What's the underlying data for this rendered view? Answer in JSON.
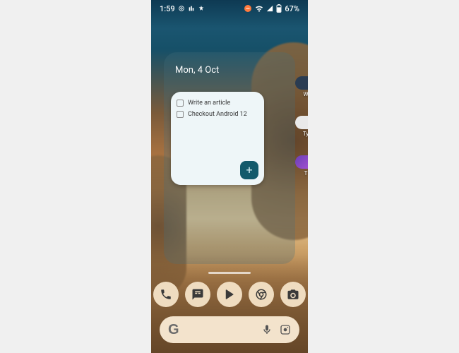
{
  "status": {
    "time": "1:59",
    "battery_pct": "67%"
  },
  "date_widget": {
    "label": "Mon, 4 Oct"
  },
  "todo": {
    "items": [
      {
        "text": "Write an article"
      },
      {
        "text": "Checkout Android 12"
      }
    ],
    "fab": "+"
  },
  "edge_apps": [
    {
      "label": "W",
      "color": "#2a3c52"
    },
    {
      "label": "Ty",
      "color": "#e9e9e9"
    },
    {
      "label": "T",
      "color": "#6a3fb5"
    }
  ],
  "dock": {
    "phone": "Phone",
    "messages": "Messages",
    "play": "Play Store",
    "chrome": "Chrome",
    "camera": "Camera"
  },
  "search": {
    "g": "G"
  },
  "colors": {
    "dock_bg": "#efdcc0",
    "search_bg": "#f3e3cc",
    "todo_card": "#eef6f8",
    "todo_fab": "#135a6b",
    "status_accent": "#ff7a3d"
  }
}
